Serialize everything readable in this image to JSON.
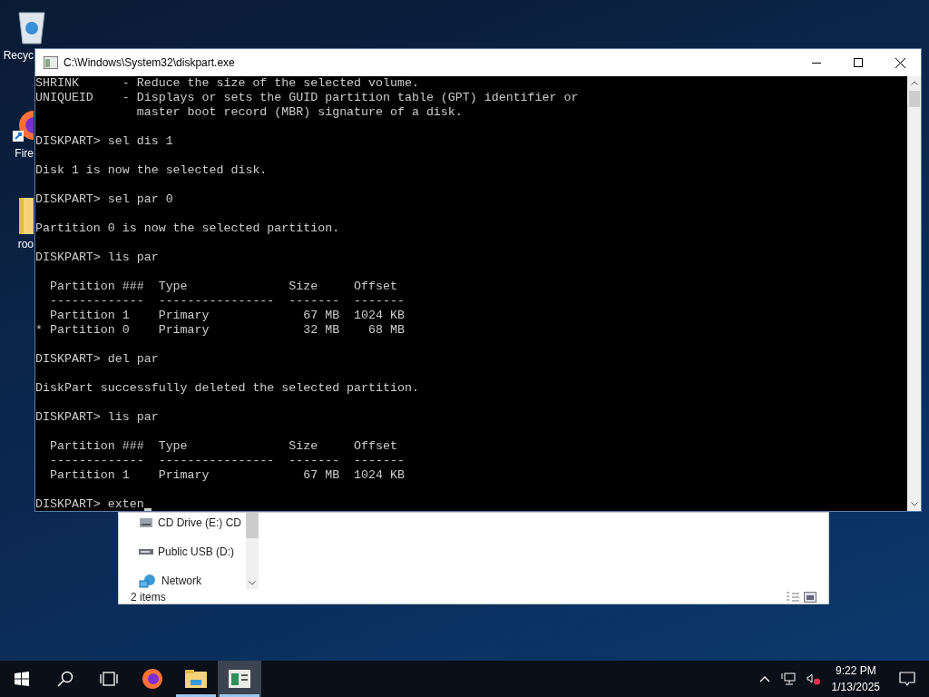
{
  "desktop_icons": [
    {
      "label": "Recyc",
      "kind": "recycle"
    },
    {
      "label": "Fire",
      "kind": "browser"
    },
    {
      "label": "roo",
      "kind": "folder"
    }
  ],
  "explorer": {
    "nav_items": [
      {
        "label": "CD Drive (E:) CD",
        "kind": "cd"
      },
      {
        "label": "Public USB (D:)",
        "kind": "usb"
      },
      {
        "label": "Network",
        "kind": "network"
      }
    ],
    "status": "2 items"
  },
  "console": {
    "title": "C:\\Windows\\System32\\diskpart.exe",
    "blocks": [
      [
        "SHRINK      - Reduce the size of the selected volume.",
        "UNIQUEID    - Displays or sets the GUID partition table (GPT) identifier or",
        "              master boot record (MBR) signature of a disk."
      ],
      [
        "DISKPART> sel dis 1"
      ],
      [
        "Disk 1 is now the selected disk."
      ],
      [
        "DISKPART> sel par 0"
      ],
      [
        "Partition 0 is now the selected partition."
      ],
      [
        "DISKPART> lis par"
      ],
      [
        "  Partition ###  Type              Size     Offset",
        "  -------------  ----------------  -------  -------",
        "  Partition 1    Primary             67 MB  1024 KB",
        "* Partition 0    Primary             32 MB    68 MB"
      ],
      [
        "DISKPART> del par"
      ],
      [
        "DiskPart successfully deleted the selected partition."
      ],
      [
        "DISKPART> lis par"
      ],
      [
        "  Partition ###  Type              Size     Offset",
        "  -------------  ----------------  -------  -------",
        "  Partition 1    Primary             67 MB  1024 KB"
      ]
    ],
    "prompt": "DISKPART> exten",
    "cursor": true
  },
  "taskbar": {
    "apps": [
      {
        "kind": "browser",
        "running": false,
        "selected": false
      },
      {
        "kind": "explorer",
        "running": true,
        "selected": false
      },
      {
        "kind": "console",
        "running": true,
        "selected": true
      }
    ],
    "time": "9:22 PM",
    "date": "1/13/2025"
  }
}
